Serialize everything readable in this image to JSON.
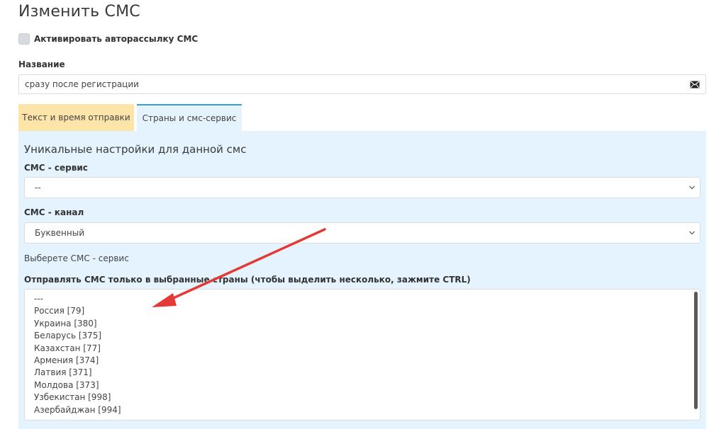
{
  "page": {
    "title": "Изменить СМС"
  },
  "activate": {
    "label": "Активировать авторассылку СМС",
    "checked": false
  },
  "name_field": {
    "label": "Название",
    "value": "сразу после регистрации",
    "icon": "envelope-icon"
  },
  "tabs": [
    {
      "label": "Текст и время отправки",
      "color": "#fde4a8",
      "active": false
    },
    {
      "label": "Страны и смс-сервис",
      "color": "#e4f3fd",
      "active": true
    }
  ],
  "panel": {
    "heading": "Уникальные настройки для данной смс",
    "sms_service": {
      "label": "СМС - сервис",
      "value": "--"
    },
    "sms_channel": {
      "label": "СМС - канал",
      "value": "Буквенный"
    },
    "hint": "Выберете СМС - сервис",
    "countries": {
      "label": "Отправлять СМС только в выбранные страны (чтобы выделить несколько, зажмите CTRL)",
      "options": [
        "---",
        "Россия [79]",
        "Украина [380]",
        "Беларусь [375]",
        "Казахстан [77]",
        "Армения [374]",
        "Латвия [371]",
        "Молдова [373]",
        "Узбекистан [998]",
        "Азербайджан [994]"
      ]
    }
  },
  "colors": {
    "accent": "#3d9ad8",
    "annotation_arrow": "#e53935",
    "panel_bg": "#e4f3fd"
  }
}
